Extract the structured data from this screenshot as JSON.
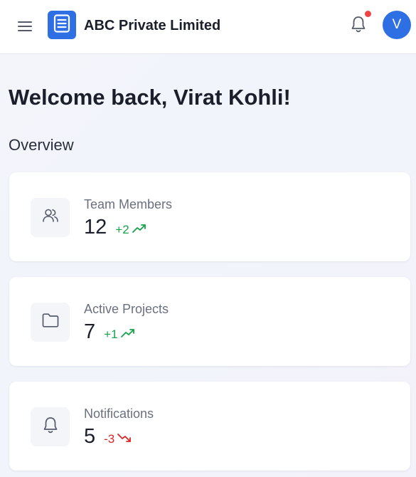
{
  "header": {
    "menu_icon": "hamburger-menu-icon",
    "logo_icon": "document-list-icon",
    "company_name": "ABC Private Limited",
    "notification_icon": "bell-icon",
    "has_unread": true,
    "avatar_initial": "V"
  },
  "main": {
    "welcome_text": "Welcome back, Virat Kohli!",
    "section_title": "Overview",
    "cards": [
      {
        "label": "Team Members",
        "value": "12",
        "delta": "+2",
        "trend": "up",
        "icon": "users-icon"
      },
      {
        "label": "Active Projects",
        "value": "7",
        "delta": "+1",
        "trend": "up",
        "icon": "folder-icon"
      },
      {
        "label": "Notifications",
        "value": "5",
        "delta": "-3",
        "trend": "down",
        "icon": "bell-icon"
      }
    ]
  },
  "colors": {
    "brand": "#2f6fe4",
    "positive": "#16a34a",
    "negative": "#dc2626",
    "unread_dot": "#ef4444"
  }
}
